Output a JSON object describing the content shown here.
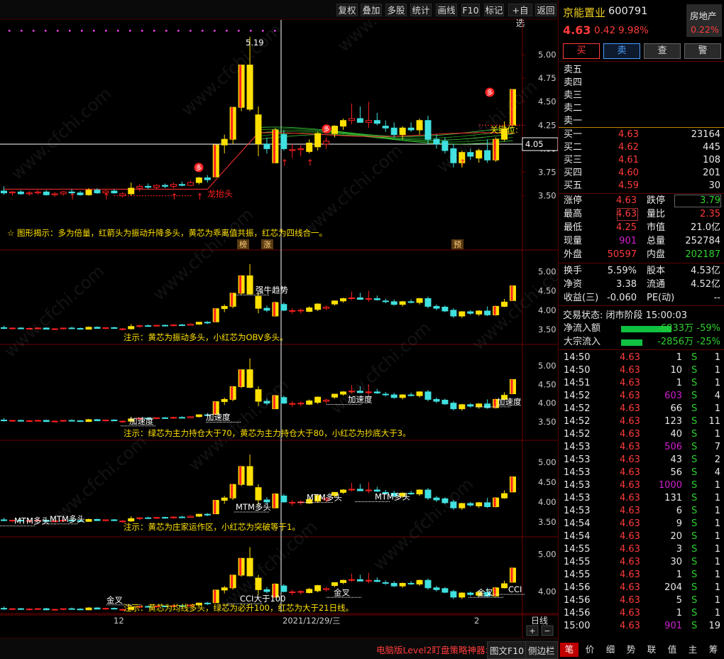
{
  "toolbar": {
    "items": [
      "复权",
      "叠加",
      "多股",
      "统计",
      "画线",
      "F10",
      "标记",
      "+自选",
      "返回"
    ]
  },
  "main": {
    "price_labels": [
      "5.00",
      "4.75",
      "4.50",
      "4.25",
      "4.00",
      "3.75",
      "3.50"
    ],
    "peak_label": "5.19",
    "key_label": "关键位:",
    "key_price": "4.05",
    "dragon_label": "龙抬头",
    "tip": "☆ 图形揭示：多为倍量，红箭头为振动升降多头，黄芯为乖离值共振，红芯为四线合一。",
    "badges": [
      "榜",
      "涨",
      "预"
    ],
    "duo_badge": "多"
  },
  "pane2": {
    "prices": [
      "5.00",
      "4.50",
      "4.00",
      "3.50"
    ],
    "label": "强牛趋势",
    "note": "注示：黄芯为振动多头，小红芯为OBV多头。"
  },
  "pane3": {
    "prices": [
      "5.00",
      "4.50",
      "4.00",
      "3.50"
    ],
    "labels": [
      "加速度",
      "加速度",
      "加速度",
      "加速度"
    ],
    "note": "注示：绿芯为主力持仓大于70，黄芯为主力持仓大于80，小红芯为抄底大于3。"
  },
  "pane4": {
    "prices": [
      "5.00",
      "4.50",
      "4.00",
      "3.50"
    ],
    "labels": [
      "MTM多头",
      "MTM多头",
      "MTM多头",
      "MTM多头",
      "MTM多头"
    ],
    "note": "注示：黄芯为庄家运作区，小红芯为突破等于1。"
  },
  "pane5": {
    "prices": [
      "5.00",
      "4.00"
    ],
    "labels": [
      "金叉",
      "金叉",
      "金叉",
      "CCI大于100",
      "CCI"
    ],
    "note": "注示：黄芯为均线多头，绿芯为必升100，红芯为大于21日线。"
  },
  "xaxis": {
    "labels": [
      "12",
      "2021/12/29/三",
      "2"
    ],
    "period": "日线"
  },
  "bottom": {
    "promo": "电脑版Level2盯盘策略神器>",
    "f10": "图文F10",
    "sidebar": "侧边栏"
  },
  "stock": {
    "name": "京能置业",
    "code": "600791",
    "sector": "房地产",
    "sector_pct": "0.22%",
    "price": "4.63",
    "change": "0.42",
    "pct": "9.98%"
  },
  "trade_buttons": [
    "买",
    "卖",
    "查",
    "警"
  ],
  "asks": [
    "卖五",
    "卖四",
    "卖三",
    "卖二",
    "卖一"
  ],
  "bids": [
    {
      "label": "买一",
      "price": "4.63",
      "vol": "23164"
    },
    {
      "label": "买二",
      "price": "4.62",
      "vol": "445"
    },
    {
      "label": "买三",
      "price": "4.61",
      "vol": "108"
    },
    {
      "label": "买四",
      "price": "4.60",
      "vol": "201"
    },
    {
      "label": "买五",
      "price": "4.59",
      "vol": "30"
    }
  ],
  "stats": [
    {
      "k1": "涨停",
      "v1": "4.63",
      "k2": "跌停",
      "v2": "3.79"
    },
    {
      "k1": "最高",
      "v1": "4.63",
      "k2": "量比",
      "v2": "2.35"
    },
    {
      "k1": "最低",
      "v1": "4.25",
      "k2": "市值",
      "v2": "21.0亿"
    },
    {
      "k1": "现量",
      "v1": "901",
      "k2": "总量",
      "v2": "252784"
    },
    {
      "k1": "外盘",
      "v1": "50597",
      "k2": "内盘",
      "v2": "202187"
    },
    {
      "k1": "换手",
      "v1": "5.59%",
      "k2": "股本",
      "v2": "4.53亿"
    },
    {
      "k1": "净资",
      "v1": "3.38",
      "k2": "流通",
      "v2": "4.52亿"
    },
    {
      "k1": "收益(三)",
      "v1": "-0.060",
      "k2": "PE(动)",
      "v2": "--"
    }
  ],
  "status": "交易状态: 闭市阶段 15:00:03",
  "flows": [
    {
      "label": "净流入额",
      "value": "-6833万",
      "pct": "-59%",
      "bar": 0.59
    },
    {
      "label": "大宗流入",
      "value": "-2856万",
      "pct": "-25%",
      "bar": 0.25
    }
  ],
  "ticks": [
    {
      "t": "14:50",
      "p": "4.63",
      "v": "1",
      "s": "S",
      "n": "1",
      "c": "w"
    },
    {
      "t": "14:50",
      "p": "4.63",
      "v": "10",
      "s": "S",
      "n": "1",
      "c": "w"
    },
    {
      "t": "14:51",
      "p": "4.63",
      "v": "1",
      "s": "S",
      "n": "1",
      "c": "w"
    },
    {
      "t": "14:52",
      "p": "4.63",
      "v": "603",
      "s": "S",
      "n": "4",
      "c": "p"
    },
    {
      "t": "14:52",
      "p": "4.63",
      "v": "66",
      "s": "S",
      "n": "1",
      "c": "w"
    },
    {
      "t": "14:52",
      "p": "4.63",
      "v": "123",
      "s": "S",
      "n": "11",
      "c": "w"
    },
    {
      "t": "14:52",
      "p": "4.63",
      "v": "40",
      "s": "S",
      "n": "1",
      "c": "w"
    },
    {
      "t": "14:53",
      "p": "4.63",
      "v": "506",
      "s": "S",
      "n": "7",
      "c": "p"
    },
    {
      "t": "14:53",
      "p": "4.63",
      "v": "43",
      "s": "S",
      "n": "2",
      "c": "w"
    },
    {
      "t": "14:53",
      "p": "4.63",
      "v": "56",
      "s": "S",
      "n": "4",
      "c": "w"
    },
    {
      "t": "14:53",
      "p": "4.63",
      "v": "1000",
      "s": "S",
      "n": "1",
      "c": "p"
    },
    {
      "t": "14:53",
      "p": "4.63",
      "v": "131",
      "s": "S",
      "n": "1",
      "c": "w"
    },
    {
      "t": "14:53",
      "p": "4.63",
      "v": "6",
      "s": "S",
      "n": "1",
      "c": "w"
    },
    {
      "t": "14:54",
      "p": "4.63",
      "v": "9",
      "s": "S",
      "n": "1",
      "c": "w"
    },
    {
      "t": "14:54",
      "p": "4.63",
      "v": "20",
      "s": "S",
      "n": "1",
      "c": "w"
    },
    {
      "t": "14:55",
      "p": "4.63",
      "v": "3",
      "s": "S",
      "n": "1",
      "c": "w"
    },
    {
      "t": "14:55",
      "p": "4.63",
      "v": "30",
      "s": "S",
      "n": "1",
      "c": "w"
    },
    {
      "t": "14:55",
      "p": "4.63",
      "v": "1",
      "s": "S",
      "n": "1",
      "c": "w"
    },
    {
      "t": "14:56",
      "p": "4.63",
      "v": "204",
      "s": "S",
      "n": "1",
      "c": "w"
    },
    {
      "t": "14:56",
      "p": "4.63",
      "v": "5",
      "s": "S",
      "n": "1",
      "c": "w"
    },
    {
      "t": "14:56",
      "p": "4.63",
      "v": "1",
      "s": "S",
      "n": "1",
      "c": "w"
    },
    {
      "t": "15:00",
      "p": "4.63",
      "v": "901",
      "s": "S",
      "n": "19",
      "c": "p"
    }
  ],
  "bottom_tabs": [
    "笔",
    "价",
    "细",
    "势",
    "联",
    "值",
    "主",
    "筹"
  ],
  "watermark": "www.cfchi.com",
  "candles": [
    [
      3.55,
      3.6,
      3.51,
      3.53
    ],
    [
      3.53,
      3.55,
      3.5,
      3.54
    ],
    [
      3.54,
      3.56,
      3.51,
      3.52
    ],
    [
      3.52,
      3.55,
      3.5,
      3.53
    ],
    [
      3.53,
      3.56,
      3.51,
      3.54
    ],
    [
      3.54,
      3.56,
      3.5,
      3.51
    ],
    [
      3.51,
      3.54,
      3.49,
      3.52
    ],
    [
      3.52,
      3.55,
      3.5,
      3.54
    ],
    [
      3.54,
      3.57,
      3.52,
      3.53
    ],
    [
      3.53,
      3.55,
      3.5,
      3.51
    ],
    [
      3.51,
      3.58,
      3.5,
      3.56
    ],
    [
      3.56,
      3.58,
      3.52,
      3.53
    ],
    [
      3.53,
      3.56,
      3.51,
      3.55
    ],
    [
      3.55,
      3.57,
      3.52,
      3.53
    ],
    [
      3.5,
      3.54,
      3.48,
      3.52
    ],
    [
      3.52,
      3.64,
      3.5,
      3.58
    ],
    [
      3.58,
      3.62,
      3.55,
      3.6
    ],
    [
      3.6,
      3.63,
      3.57,
      3.59
    ],
    [
      3.59,
      3.62,
      3.57,
      3.61
    ],
    [
      3.61,
      3.63,
      3.58,
      3.6
    ],
    [
      3.6,
      3.64,
      3.58,
      3.62
    ],
    [
      3.62,
      3.65,
      3.6,
      3.61
    ],
    [
      3.61,
      3.66,
      3.6,
      3.64
    ],
    [
      3.64,
      3.7,
      3.62,
      3.69
    ],
    [
      3.69,
      3.72,
      3.64,
      3.67
    ],
    [
      3.7,
      4.04,
      3.7,
      4.04
    ],
    [
      4.04,
      4.15,
      3.95,
      4.1
    ],
    [
      4.1,
      4.44,
      4.05,
      4.44
    ],
    [
      4.44,
      4.89,
      4.4,
      4.89
    ],
    [
      4.89,
      5.19,
      4.4,
      4.42
    ],
    [
      4.36,
      4.45,
      3.92,
      4.05
    ],
    [
      4.05,
      4.12,
      3.95,
      4.0
    ],
    [
      3.85,
      4.22,
      3.85,
      4.2
    ],
    [
      4.15,
      4.2,
      3.98,
      4.0
    ],
    [
      3.98,
      4.05,
      3.9,
      3.99
    ],
    [
      3.99,
      4.04,
      3.92,
      4.0
    ],
    [
      3.97,
      4.1,
      3.95,
      4.06
    ],
    [
      4.02,
      4.18,
      3.98,
      4.16
    ],
    [
      4.05,
      4.12,
      4.0,
      4.08
    ],
    [
      4.16,
      4.25,
      4.12,
      4.24
    ],
    [
      4.24,
      4.32,
      4.2,
      4.3
    ],
    [
      4.3,
      4.48,
      4.26,
      4.32
    ],
    [
      4.32,
      4.45,
      4.3,
      4.28
    ],
    [
      4.28,
      4.5,
      4.22,
      4.3
    ],
    [
      4.3,
      4.38,
      4.25,
      4.27
    ],
    [
      4.24,
      4.3,
      4.18,
      4.22
    ],
    [
      4.22,
      4.28,
      4.12,
      4.15
    ],
    [
      4.15,
      4.24,
      4.1,
      4.22
    ],
    [
      4.22,
      4.28,
      4.18,
      4.2
    ],
    [
      4.2,
      4.32,
      4.15,
      4.3
    ],
    [
      4.3,
      4.35,
      4.05,
      4.1
    ],
    [
      4.1,
      4.15,
      4.0,
      4.05
    ],
    [
      4.08,
      4.12,
      3.95,
      3.98
    ],
    [
      4.0,
      4.05,
      3.8,
      3.85
    ],
    [
      3.85,
      3.98,
      3.8,
      3.96
    ],
    [
      3.96,
      4.0,
      3.88,
      3.92
    ],
    [
      3.9,
      4.0,
      3.85,
      3.98
    ],
    [
      3.98,
      4.1,
      3.85,
      3.88
    ],
    [
      3.88,
      4.12,
      3.86,
      4.1
    ],
    [
      4.1,
      4.29,
      4.08,
      4.21
    ],
    [
      4.25,
      4.63,
      4.25,
      4.63
    ]
  ]
}
